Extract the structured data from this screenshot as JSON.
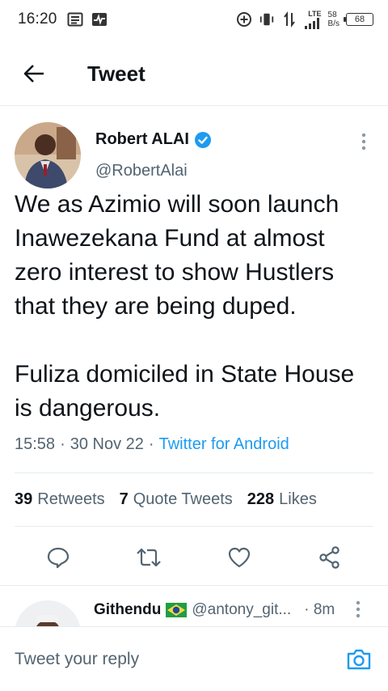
{
  "status_bar": {
    "time": "16:20",
    "lte": "LTE",
    "speed_value": "58",
    "speed_unit": "B/s",
    "battery": "68"
  },
  "header": {
    "title": "Tweet"
  },
  "tweet": {
    "author_name": "Robert ALAI",
    "handle": "@RobertAlai",
    "text": "We as Azimio will soon launch Inawezekana Fund at almost zero interest to show Hustlers that they are being duped.\n\nFuliza domiciled in State House is dangerous.",
    "time": "15:58",
    "date": "30 Nov 22",
    "source": "Twitter for Android",
    "retweets": "39",
    "retweets_label": "Retweets",
    "quotes": "7",
    "quotes_label": "Quote Tweets",
    "likes": "228",
    "likes_label": "Likes"
  },
  "reply_preview": {
    "name": "Githendu",
    "handle": "@antony_git...",
    "time": "8m"
  },
  "composer": {
    "placeholder": "Tweet your reply"
  },
  "colors": {
    "accent": "#1d9bf0",
    "text": "#0f1419",
    "secondary": "#536471",
    "divider": "#e6ecf0"
  }
}
